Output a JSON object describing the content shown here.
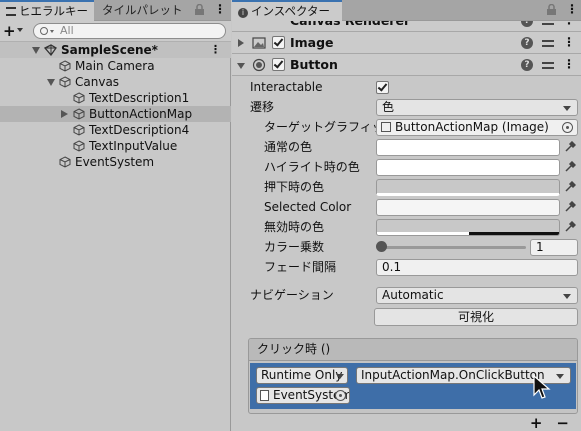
{
  "hierarchy": {
    "tab_label": "ヒエラルキー",
    "tab2_label": "タイルパレット",
    "search_placeholder": "All",
    "scene_name": "SampleScene*",
    "items": [
      {
        "label": "Main Camera"
      },
      {
        "label": "Canvas"
      },
      {
        "label": "TextDescription1"
      },
      {
        "label": "ButtonActionMap"
      },
      {
        "label": "TextDescription4"
      },
      {
        "label": "TextInputValue"
      },
      {
        "label": "EventSystem"
      }
    ]
  },
  "inspector": {
    "tab_label": "インスペクター",
    "components": {
      "canvas_renderer": "Canvas Renderer",
      "image": "Image",
      "button": "Button"
    },
    "props": {
      "interactable": "Interactable",
      "transition": "遷移",
      "transition_value": "色",
      "target_graphic": "ターゲットグラフィックス",
      "target_graphic_value": "ButtonActionMap (Image)",
      "normal_color": "通常の色",
      "highlight_color": "ハイライト時の色",
      "pressed_color": "押下時の色",
      "selected_color": "Selected Color",
      "disabled_color": "無効時の色",
      "color_multiplier": "カラー乗数",
      "color_multiplier_value": "1",
      "fade_duration": "フェード間隔",
      "fade_duration_value": "0.1",
      "navigation": "ナビゲーション",
      "navigation_value": "Automatic",
      "visualize": "可視化"
    },
    "event": {
      "title": "クリック時 ()",
      "runtime": "Runtime Only",
      "function": "InputActionMap.OnClickButton",
      "object": "EventSystem"
    },
    "footer": {
      "plus": "+",
      "minus": "−"
    }
  }
}
